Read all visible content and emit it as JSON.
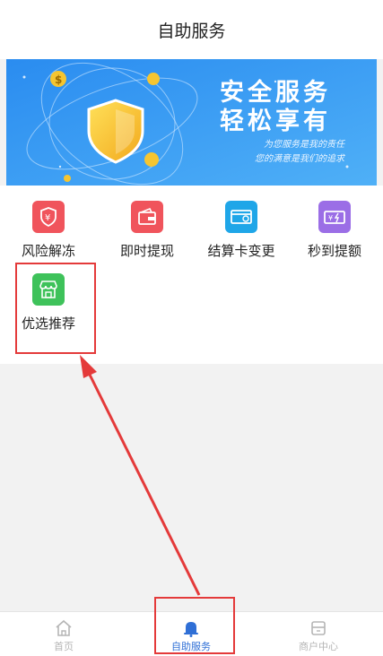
{
  "header": {
    "title": "自助服务"
  },
  "banner": {
    "headline_1": "安全服务",
    "headline_2": "轻松享有",
    "tagline_1": "为您服务是我的责任",
    "tagline_2": "您的满意是我们的追求"
  },
  "services": [
    {
      "label": "风险解冻",
      "icon": "yen-shield-icon",
      "color": "#f0545c"
    },
    {
      "label": "即时提现",
      "icon": "wallet-icon",
      "color": "#f0545c"
    },
    {
      "label": "结算卡变更",
      "icon": "card-change-icon",
      "color": "#1fa6e8"
    },
    {
      "label": "秒到提额",
      "icon": "quick-limit-icon",
      "color": "#9b6ee6"
    },
    {
      "label": "优选推荐",
      "icon": "store-icon",
      "color": "#3ec25a"
    }
  ],
  "tabbar": {
    "items": [
      {
        "label": "首页",
        "icon": "home-icon",
        "active": false
      },
      {
        "label": "自助服务",
        "icon": "bell-icon",
        "active": true
      },
      {
        "label": "商户中心",
        "icon": "merchant-icon",
        "active": false
      }
    ],
    "active_color": "#2f6fd6",
    "inactive_color": "#b5b5b5"
  },
  "annotation": {
    "color": "#e43a3a"
  }
}
